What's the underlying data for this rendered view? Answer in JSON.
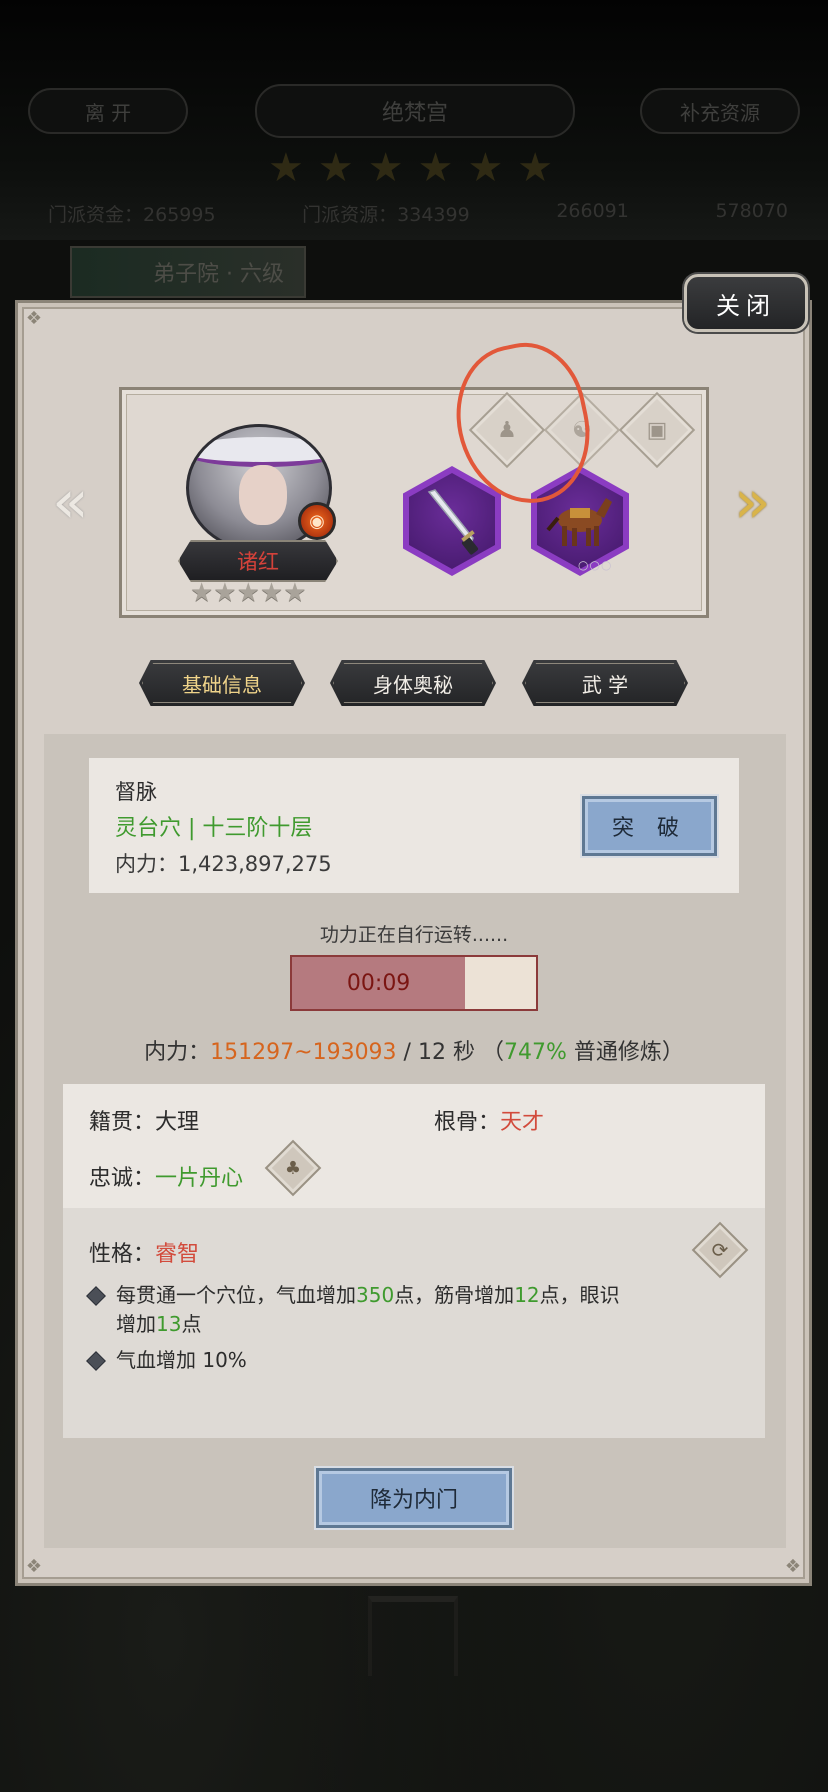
{
  "background": {
    "leave_button": "离 开",
    "sect_title": "绝梵宫",
    "resupply_button": "补充资源",
    "star_count": 6,
    "stat_gold_label": "门派资金：",
    "stat_gold_value": "265995",
    "stat_resource_label": "门派资源：",
    "stat_resource_value": "334399",
    "stat_3": "266091",
    "stat_4": "578070",
    "hall_label": "弟子院 · 六级"
  },
  "panel": {
    "close_button": "关闭"
  },
  "character": {
    "name": "诸红",
    "stars": 5,
    "star_glyphs": "★★★★★",
    "weapon_icon": "saber-icon",
    "mount_icon": "horse-icon",
    "mount_dots": "○○○"
  },
  "tabs": [
    {
      "label": "基础信息",
      "active": true
    },
    {
      "label": "身体奥秘",
      "active": false
    },
    {
      "label": "武 学",
      "active": false
    }
  ],
  "meridian": {
    "title": "督脉",
    "point": "灵台穴 | 十三阶十层",
    "power": "内力：1,423,897,275",
    "break_button": "突 破"
  },
  "cultivation": {
    "status": "功力正在自行运转......",
    "timer": "00:09",
    "progress": 0.71,
    "power_label": "内力：",
    "power_range": "151297~193093",
    "per_time": " / 12 秒 （",
    "percent": "747%",
    "mode": " 普通修炼）"
  },
  "attributes": {
    "origin_label": "籍贯：",
    "origin_value": "大理",
    "aptitude_label": "根骨：",
    "aptitude_value": "天才",
    "loyalty_label": "忠诚：",
    "loyalty_value": "一片丹心"
  },
  "trait": {
    "label": "性格：",
    "value": "睿智",
    "line1_a": "每贯通一个穴位，气血增加",
    "line1_b": "350",
    "line1_c": "点，筋骨增加",
    "line1_d": "12",
    "line1_e": "点，眼识",
    "line2_a": "增加",
    "line2_b": "13",
    "line2_c": "点",
    "line3": "气血增加 10%"
  },
  "footer": {
    "demote_button": "降为内门"
  },
  "colors": {
    "panel": "#d6cfc8",
    "button_blue": "#8aa7cc",
    "gear_purple": "#8b3cc2",
    "accent_green": "#3f9a2e",
    "accent_orange": "#d6651e",
    "accent_red": "#d24b3c"
  }
}
